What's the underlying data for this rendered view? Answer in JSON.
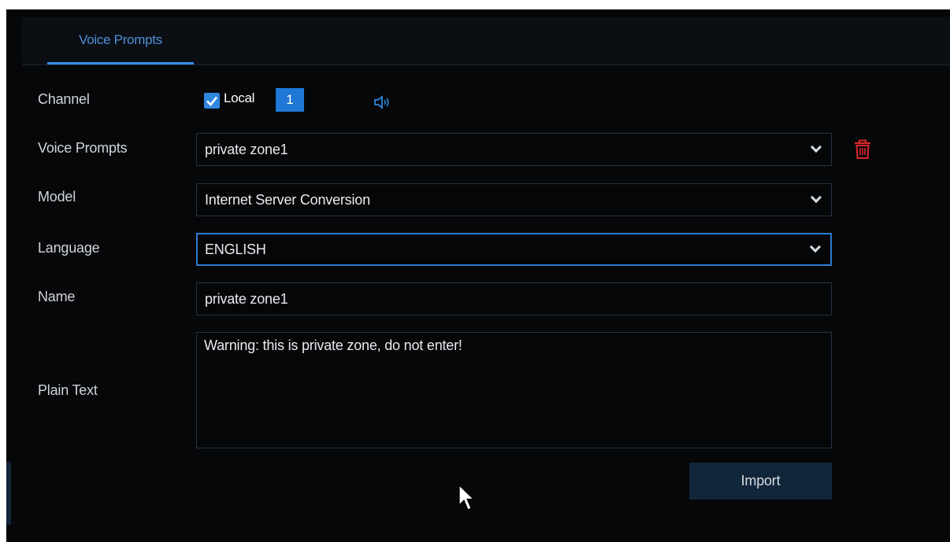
{
  "tabs": [
    {
      "label": "Voice Prompts",
      "active": true
    }
  ],
  "form": {
    "channel": {
      "label": "Channel",
      "local_checked": true,
      "local_label": "Local",
      "channel_number": "1"
    },
    "voice_prompts": {
      "label": "Voice Prompts",
      "value": "private zone1"
    },
    "model": {
      "label": "Model",
      "value": "Internet Server Conversion"
    },
    "language": {
      "label": "Language",
      "value": "ENGLISH"
    },
    "name": {
      "label": "Name",
      "value": "private zone1"
    },
    "plain_text": {
      "label": "Plain Text",
      "value": "Warning: this is private zone, do not enter!"
    },
    "import_label": "Import"
  },
  "icons": {
    "speaker": "speaker-icon",
    "delete": "trash-icon",
    "dropdown": "chevron-down-icon",
    "checkbox": "checkmark-icon",
    "cursor": "mouse-pointer-icon"
  },
  "colors": {
    "accent": "#2f87e0",
    "background": "#060709",
    "delete": "#d8262a",
    "button": "#12263b"
  }
}
